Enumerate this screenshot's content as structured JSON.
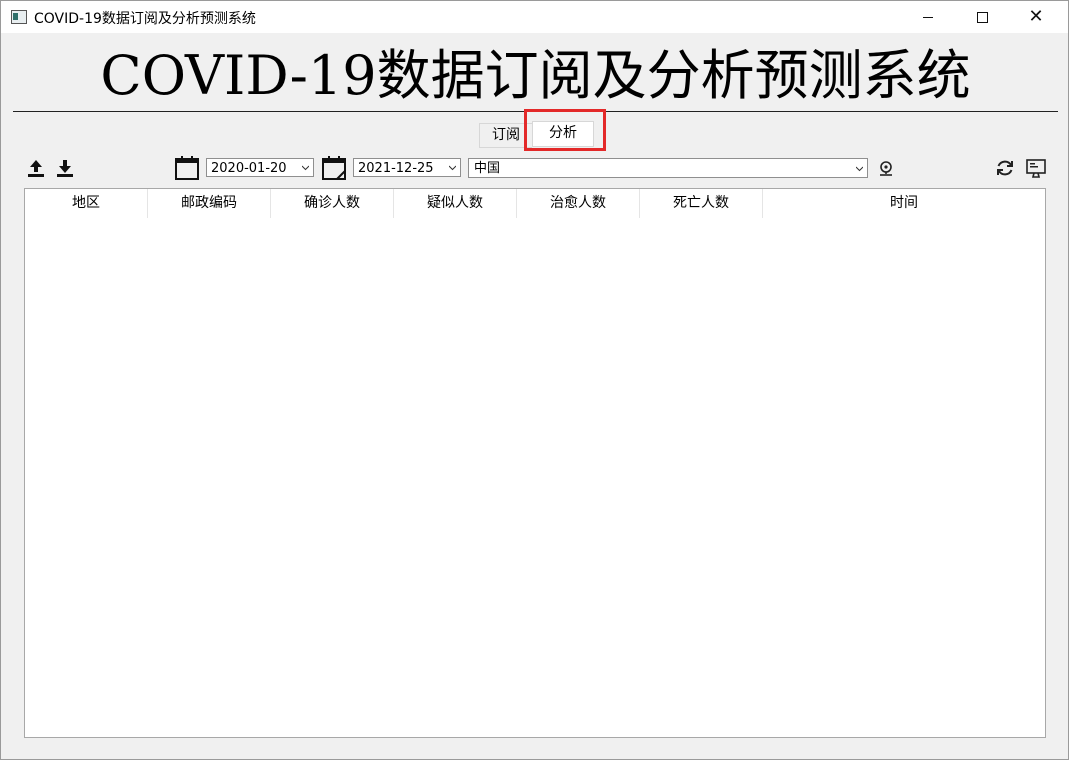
{
  "window": {
    "title": "COVID-19数据订阅及分析预测系统",
    "close_symbol": "✕"
  },
  "header": {
    "title": "COVID-19数据订阅及分析预测系统"
  },
  "tabs": [
    {
      "label": "订阅"
    },
    {
      "label": "分析"
    }
  ],
  "toolbar": {
    "icons": [
      "upload-icon",
      "download-icon",
      "start-calendar-icon",
      "end-calendar-icon",
      "location-icon",
      "refresh-icon",
      "screen-icon"
    ],
    "start_date": "2020-01-20",
    "end_date": "2021-12-25",
    "region": "中国"
  },
  "table": {
    "columns": [
      "地区",
      "邮政编码",
      "确诊人数",
      "疑似人数",
      "治愈人数",
      "死亡人数",
      "时间"
    ]
  },
  "colors": {
    "highlight": "#e32929",
    "background": "#f0f0f0"
  }
}
